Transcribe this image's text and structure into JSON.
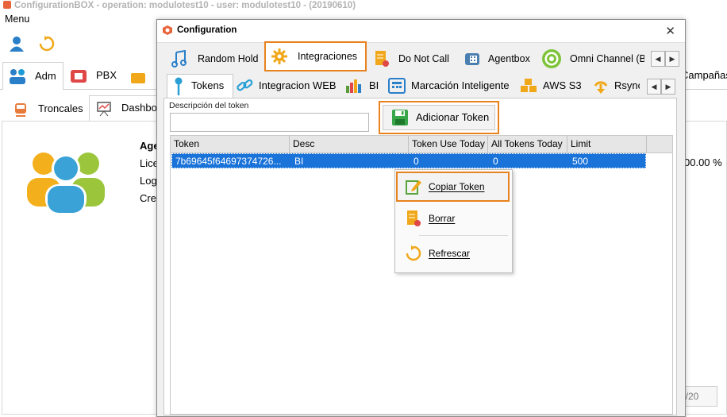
{
  "app": {
    "title": "ConfigurationBOX  -  operation: modulotest10 - user: modulotest10 - (20190610)",
    "menu_label": "Menu",
    "tabs": [
      "Adm",
      "PBX"
    ],
    "subtabs": [
      "Troncales",
      "Dashbo"
    ],
    "side_labels": [
      "Age",
      "Lice",
      "Log",
      "Cre"
    ],
    "right_tab_fragment": "Campañas",
    "percent_text": "00.00 %",
    "page_counter": "0/20"
  },
  "dialog": {
    "title": "Configuration",
    "close_glyph": "✕",
    "top_tabs": [
      "Random Hold",
      "Integraciones",
      "Do Not Call",
      "Agentbox",
      "Omni Channel (Bo"
    ],
    "sec_tabs": [
      "Tokens",
      "Integracion WEB",
      "BI",
      "Marcación Inteligente",
      "AWS S3",
      "Rsync"
    ],
    "desc_label": "Descripción del token",
    "desc_value": "",
    "add_button_label": "Adicionar Token",
    "grid": {
      "columns": [
        "Token",
        "Desc",
        "Token Use Today",
        "All Tokens Today",
        "Limit"
      ],
      "rows": [
        [
          "7b69645f64697374726...",
          "BI",
          "0",
          "0",
          "500"
        ]
      ]
    },
    "context_menu": [
      "Copiar Token",
      "Borrar",
      "Refrescar"
    ]
  },
  "colors": {
    "highlight": "#e8821e",
    "selection": "#1a73d9"
  }
}
